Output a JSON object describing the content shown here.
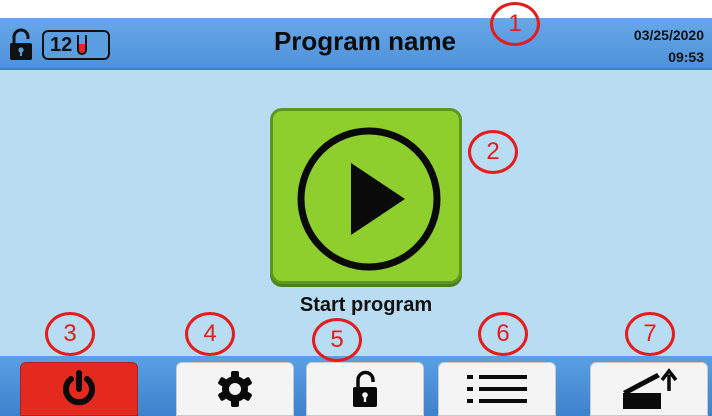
{
  "header": {
    "tube_count": "12",
    "title": "Program name",
    "date": "03/25/2020",
    "time": "09:53"
  },
  "main": {
    "start_label": "Start program"
  },
  "callouts": [
    "1",
    "2",
    "3",
    "4",
    "5",
    "6",
    "7"
  ],
  "colors": {
    "header": "#4f92da",
    "background": "#b8dcf2",
    "start_button": "#8ecf2e",
    "power_button": "#e42a1e",
    "callout": "#e41c1c"
  },
  "icons": {
    "header_lock": "padlock-open-icon",
    "tube": "test-tube-icon",
    "start": "play-icon",
    "power": "power-icon",
    "settings": "gear-icon",
    "unlock": "padlock-open-icon",
    "list": "list-icon",
    "lid": "lid-open-icon"
  }
}
